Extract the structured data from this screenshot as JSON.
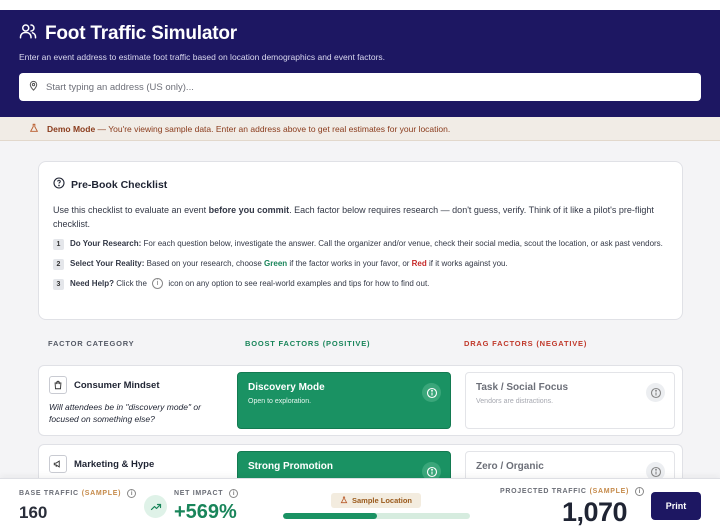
{
  "header": {
    "title": "Foot Traffic Simulator",
    "subtitle": "Enter an event address to estimate foot traffic based on location demographics and event factors.",
    "address_placeholder": "Start typing an address (US only)..."
  },
  "demo_banner": {
    "bold": "Demo Mode",
    "text": " — You're viewing sample data. Enter an address above to get real estimates for your location."
  },
  "checklist": {
    "title": "Pre-Book Checklist",
    "intro_1": "Use this checklist to evaluate an event ",
    "intro_bold": "before you commit",
    "intro_2": ". Each factor below requires research — don't guess, verify. Think of it like a pilot's pre-flight checklist.",
    "steps": [
      {
        "num": "1",
        "bold": "Do Your Research:",
        "text": " For each question below, investigate the answer. Call the organizer and/or venue, check their social media, scout the location, or ask past vendors."
      },
      {
        "num": "2",
        "bold": "Select Your Reality:",
        "text_a": " Based on your research, choose ",
        "green": "Green",
        "text_b": " if the factor works in your favor, or ",
        "red": "Red",
        "text_c": " if it works against you."
      },
      {
        "num": "3",
        "bold": "Need Help?",
        "text_a": " Click the ",
        "text_b": " icon on any option to see real-world examples and tips for how to find out."
      }
    ]
  },
  "columns": {
    "category": "FACTOR CATEGORY",
    "boost": "BOOST FACTORS (POSITIVE)",
    "drag_a": "DRAG FACTORS (",
    "drag_b": "NEGATIVE",
    "drag_c": ")"
  },
  "factors": [
    {
      "name": "Consumer Mindset",
      "question": "Will attendees be in \"discovery mode\" or focused on something else?",
      "icon": "shopping-bag-icon",
      "boost": {
        "title": "Discovery Mode",
        "sub": "Open to exploration."
      },
      "drag": {
        "title": "Task / Social Focus",
        "sub": "Vendors are distractions."
      }
    },
    {
      "name": "Marketing & Hype",
      "icon": "megaphone-icon",
      "boost": {
        "title": "Strong Promotion"
      },
      "drag": {
        "title": "Zero / Organic"
      }
    }
  ],
  "footer": {
    "base_label": "BASE TRAFFIC",
    "sample_tag": "(SAMPLE)",
    "base_value": "160",
    "impact_label": "NET IMPACT",
    "impact_value": "+569%",
    "sample_location": "Sample Location",
    "impact_bar_fraction": 0.5,
    "projected_label": "PROJECTED TRAFFIC",
    "projected_value": "1,070",
    "print_label": "Print"
  },
  "colors": {
    "brand": "#1d1762",
    "boost": "#1a9263",
    "drag": "#c0392b",
    "demo": "#8a3b1c"
  }
}
